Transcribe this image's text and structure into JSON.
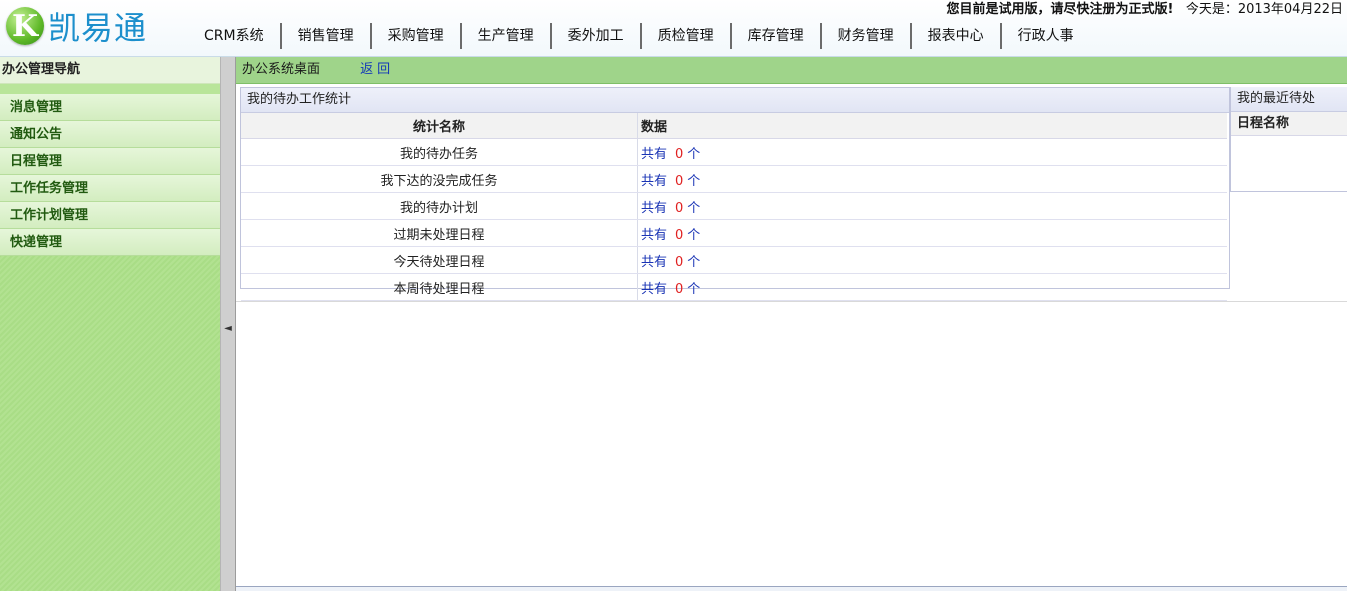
{
  "brand": {
    "logo_letter": "K",
    "name": "凯易通"
  },
  "notice": {
    "trial": "您目前是试用版，请尽快注册为正式版!",
    "today_label": "今天是：",
    "date": "2013年04月22日"
  },
  "topnav": [
    "CRM系统",
    "销售管理",
    "采购管理",
    "生产管理",
    "委外加工",
    "质检管理",
    "库存管理",
    "财务管理",
    "报表中心",
    "行政人事"
  ],
  "sidebar": {
    "title": "办公管理导航",
    "items": [
      "消息管理",
      "通知公告",
      "日程管理",
      "工作任务管理",
      "工作计划管理",
      "快递管理"
    ]
  },
  "splitter": {
    "arrow": "◄"
  },
  "main": {
    "breadcrumb": "办公系统桌面",
    "back": "返回"
  },
  "stats_panel": {
    "title": "我的待办工作统计",
    "col_name": "统计名称",
    "col_data": "数据",
    "rows": [
      {
        "name": "我的待办任务",
        "prefix": "共有",
        "count": "0",
        "unit": "个"
      },
      {
        "name": "我下达的没完成任务",
        "prefix": "共有",
        "count": "0",
        "unit": "个"
      },
      {
        "name": "我的待办计划",
        "prefix": "共有",
        "count": "0",
        "unit": "个"
      },
      {
        "name": "过期未处理日程",
        "prefix": "共有",
        "count": "0",
        "unit": "个"
      },
      {
        "name": "今天待处理日程",
        "prefix": "共有",
        "count": "0",
        "unit": "个"
      },
      {
        "name": "本周待处理日程",
        "prefix": "共有",
        "count": "0",
        "unit": "个"
      }
    ]
  },
  "recent_panel": {
    "title": "我的最近待处",
    "col_name": "日程名称"
  }
}
